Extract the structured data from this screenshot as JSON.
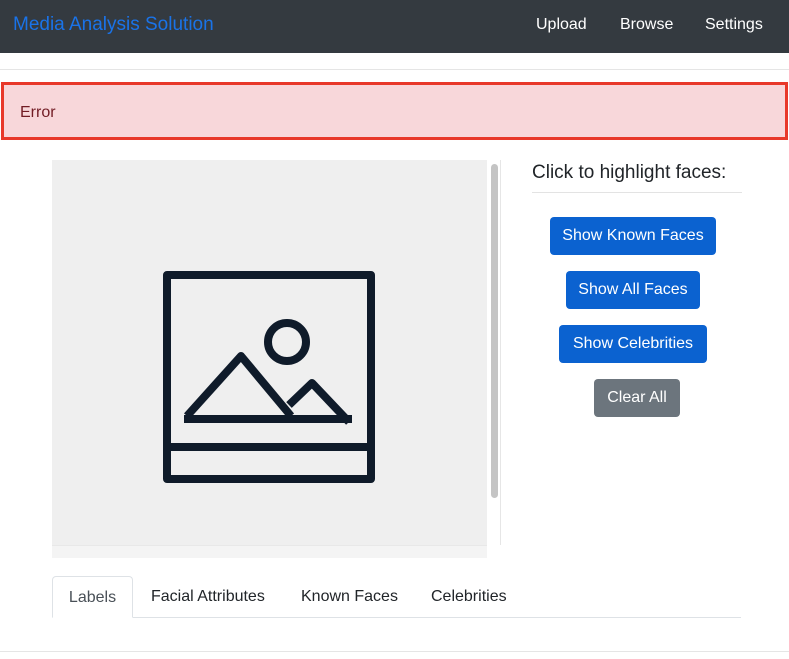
{
  "navbar": {
    "brand": "Media Analysis Solution",
    "links": [
      "Upload",
      "Browse",
      "Settings"
    ],
    "brand_color": "#1a73e8",
    "background": "#343a40"
  },
  "alert": {
    "text": "Error",
    "background": "#f8d7da",
    "border_color": "#e8382a"
  },
  "media": {
    "placeholder_icon": "image-placeholder-icon"
  },
  "faces": {
    "heading": "Click to highlight faces:",
    "buttons": {
      "known": "Show Known Faces",
      "all": "Show All Faces",
      "celebrities": "Show Celebrities",
      "clear": "Clear All"
    },
    "primary_color": "#0b62d0",
    "secondary_color": "#6c757d"
  },
  "tabs": {
    "items": [
      "Labels",
      "Facial Attributes",
      "Known Faces",
      "Celebrities"
    ],
    "active": "Labels"
  }
}
